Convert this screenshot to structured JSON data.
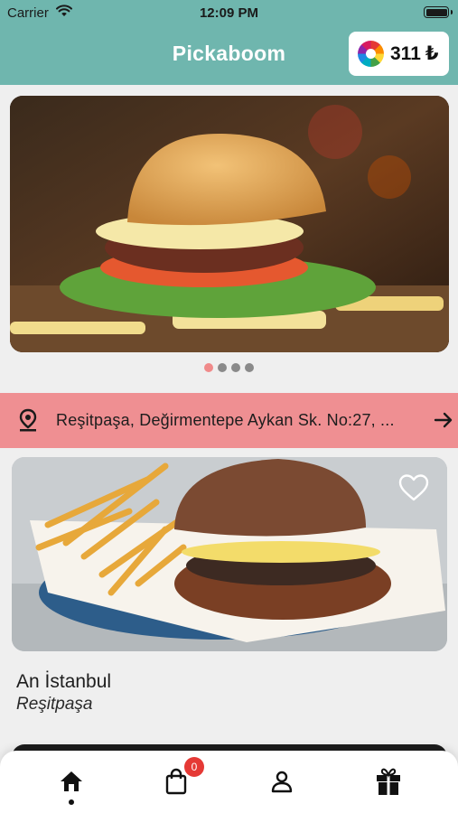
{
  "status_bar": {
    "carrier": "Carrier",
    "time": "12:09 PM"
  },
  "header": {
    "title": "Pickaboom",
    "balance": "311",
    "currency": "₺"
  },
  "carousel": {
    "page_count": 4,
    "active_index": 0
  },
  "address": {
    "text": "Reşitpaşa, Değirmentepe Aykan Sk. No:27, ..."
  },
  "restaurants": [
    {
      "name": "An İstanbul",
      "area": "Reşitpaşa"
    }
  ],
  "tab_bar": {
    "cart_badge": "0"
  },
  "colors": {
    "header": "#6fb6ae",
    "address_bar": "#ef8f92",
    "badge": "#e53935",
    "dot_active": "#f08a8a"
  }
}
